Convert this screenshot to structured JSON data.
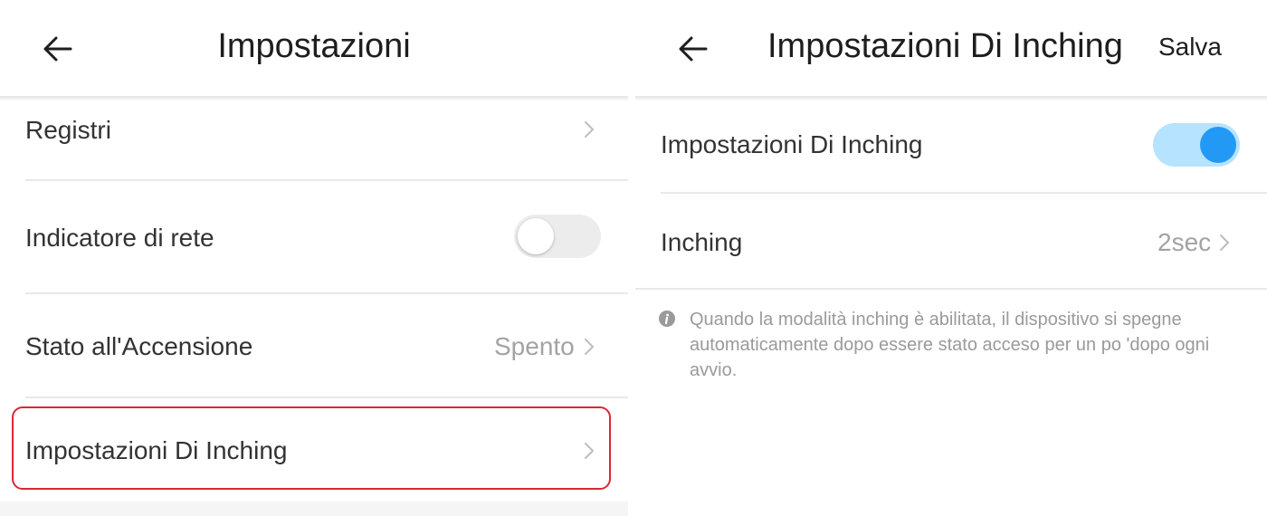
{
  "left_screen": {
    "header": {
      "title": "Impostazioni"
    },
    "items": [
      {
        "label": "Registri"
      },
      {
        "label": "Indicatore di rete",
        "toggle": "off"
      },
      {
        "label": "Stato all'Accensione",
        "value": "Spento"
      },
      {
        "label": "Impostazioni Di Inching",
        "highlighted": true
      }
    ]
  },
  "right_screen": {
    "header": {
      "title": "Impostazioni Di Inching",
      "save_label": "Salva"
    },
    "toggle_row": {
      "label": "Impostazioni Di Inching",
      "toggle": "on"
    },
    "inching_row": {
      "label": "Inching",
      "value": "2sec"
    },
    "info_text": "Quando la modalità inching è abilitata, il dispositivo si spegne automaticamente dopo essere stato acceso per un po 'dopo ogni avvio."
  },
  "colors": {
    "toggle_on_track": "#b6e3ff",
    "toggle_on_knob": "#2299f5",
    "highlight_border": "#d92834"
  }
}
